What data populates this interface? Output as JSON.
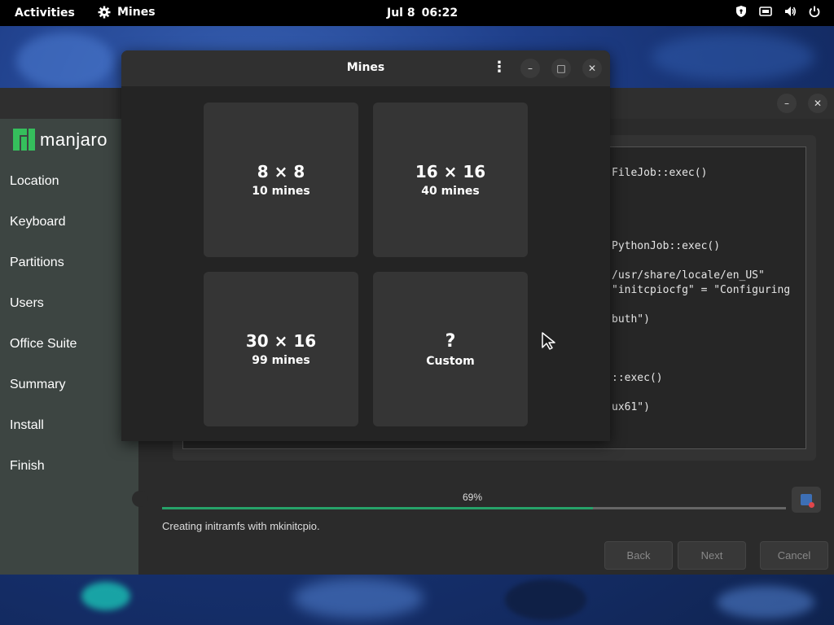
{
  "topbar": {
    "activities": "Activities",
    "app_name": "Mines",
    "date": "Jul 8",
    "time": "06:22",
    "icons": [
      "privacy-shield-icon",
      "network-icon",
      "volume-icon",
      "power-icon"
    ]
  },
  "installer": {
    "brand": "manjaro",
    "nav": [
      "Location",
      "Keyboard",
      "Partitions",
      "Users",
      "Office Suite",
      "Summary",
      "Install",
      "Finish"
    ],
    "log_lines": [
      "FileJob::exec()",
      "PythonJob::exec()",
      "/usr/share/locale/en_US\"",
      "\"initcpiocfg\" = \"Configuring",
      "buth\")",
      "::exec()",
      "ux61\")"
    ],
    "progress_text": "69%",
    "progress_value": 0.69,
    "status": "Creating initramfs with mkinitcpio.",
    "buttons": {
      "back": "Back",
      "next": "Next",
      "cancel": "Cancel"
    }
  },
  "mines": {
    "title": "Mines",
    "tiles": [
      {
        "size": "8 × 8",
        "mines": "10 mines"
      },
      {
        "size": "16 × 16",
        "mines": "40 mines"
      },
      {
        "size": "30 × 16",
        "mines": "99 mines"
      },
      {
        "symbol": "?",
        "label": "Custom"
      }
    ]
  },
  "colors": {
    "accent_progress": "#26a269",
    "manjaro_green": "#35bf5c"
  }
}
